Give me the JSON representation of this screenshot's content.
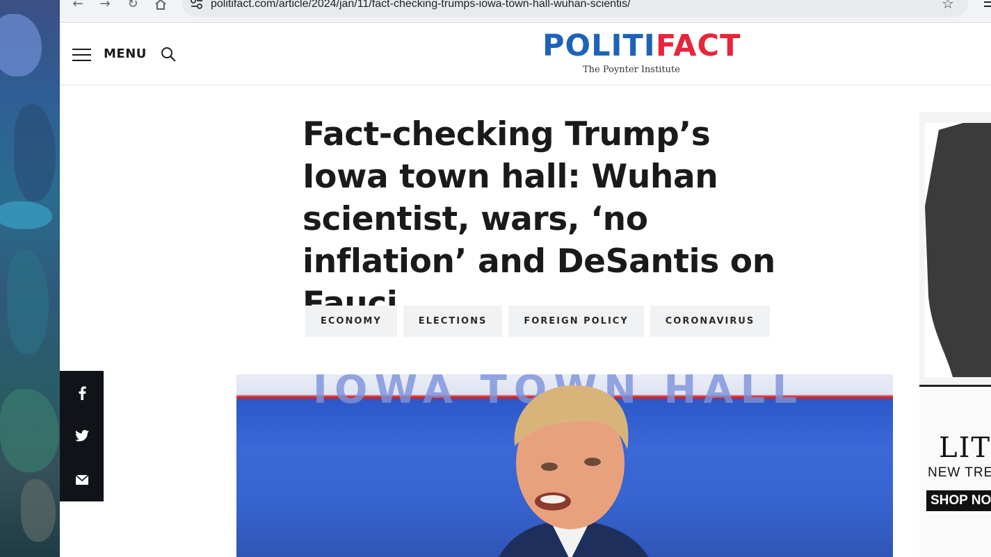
{
  "browser": {
    "url": "politifact.com/article/2024/jan/11/fact-checking-trumps-iowa-town-hall-wuhan-scientis/"
  },
  "header": {
    "menu_label": "MENU",
    "logo_part1": "POLITI",
    "logo_part2": "FACT",
    "logo_subtitle": "The Poynter Institute",
    "colors": {
      "brand_blue": "#1e63b8",
      "brand_red": "#e8253b"
    }
  },
  "article": {
    "headline": "Fact-checking Trump’s Iowa town hall: Wuhan scientist, wars, ‘no inflation’ and DeSantis on Fauci",
    "tags": [
      "ECONOMY",
      "ELECTIONS",
      "FOREIGN POLICY",
      "CORONAVIRUS"
    ],
    "hero_banner_text": "IOWA TOWN HALL"
  },
  "share": {
    "items": [
      {
        "icon": "facebook-icon"
      },
      {
        "icon": "twitter-icon"
      },
      {
        "icon": "email-icon"
      }
    ]
  },
  "ads": {
    "ad2_title": "LIT",
    "ad2_subtitle": "NEW TRE",
    "ad2_button": "SHOP NO"
  }
}
